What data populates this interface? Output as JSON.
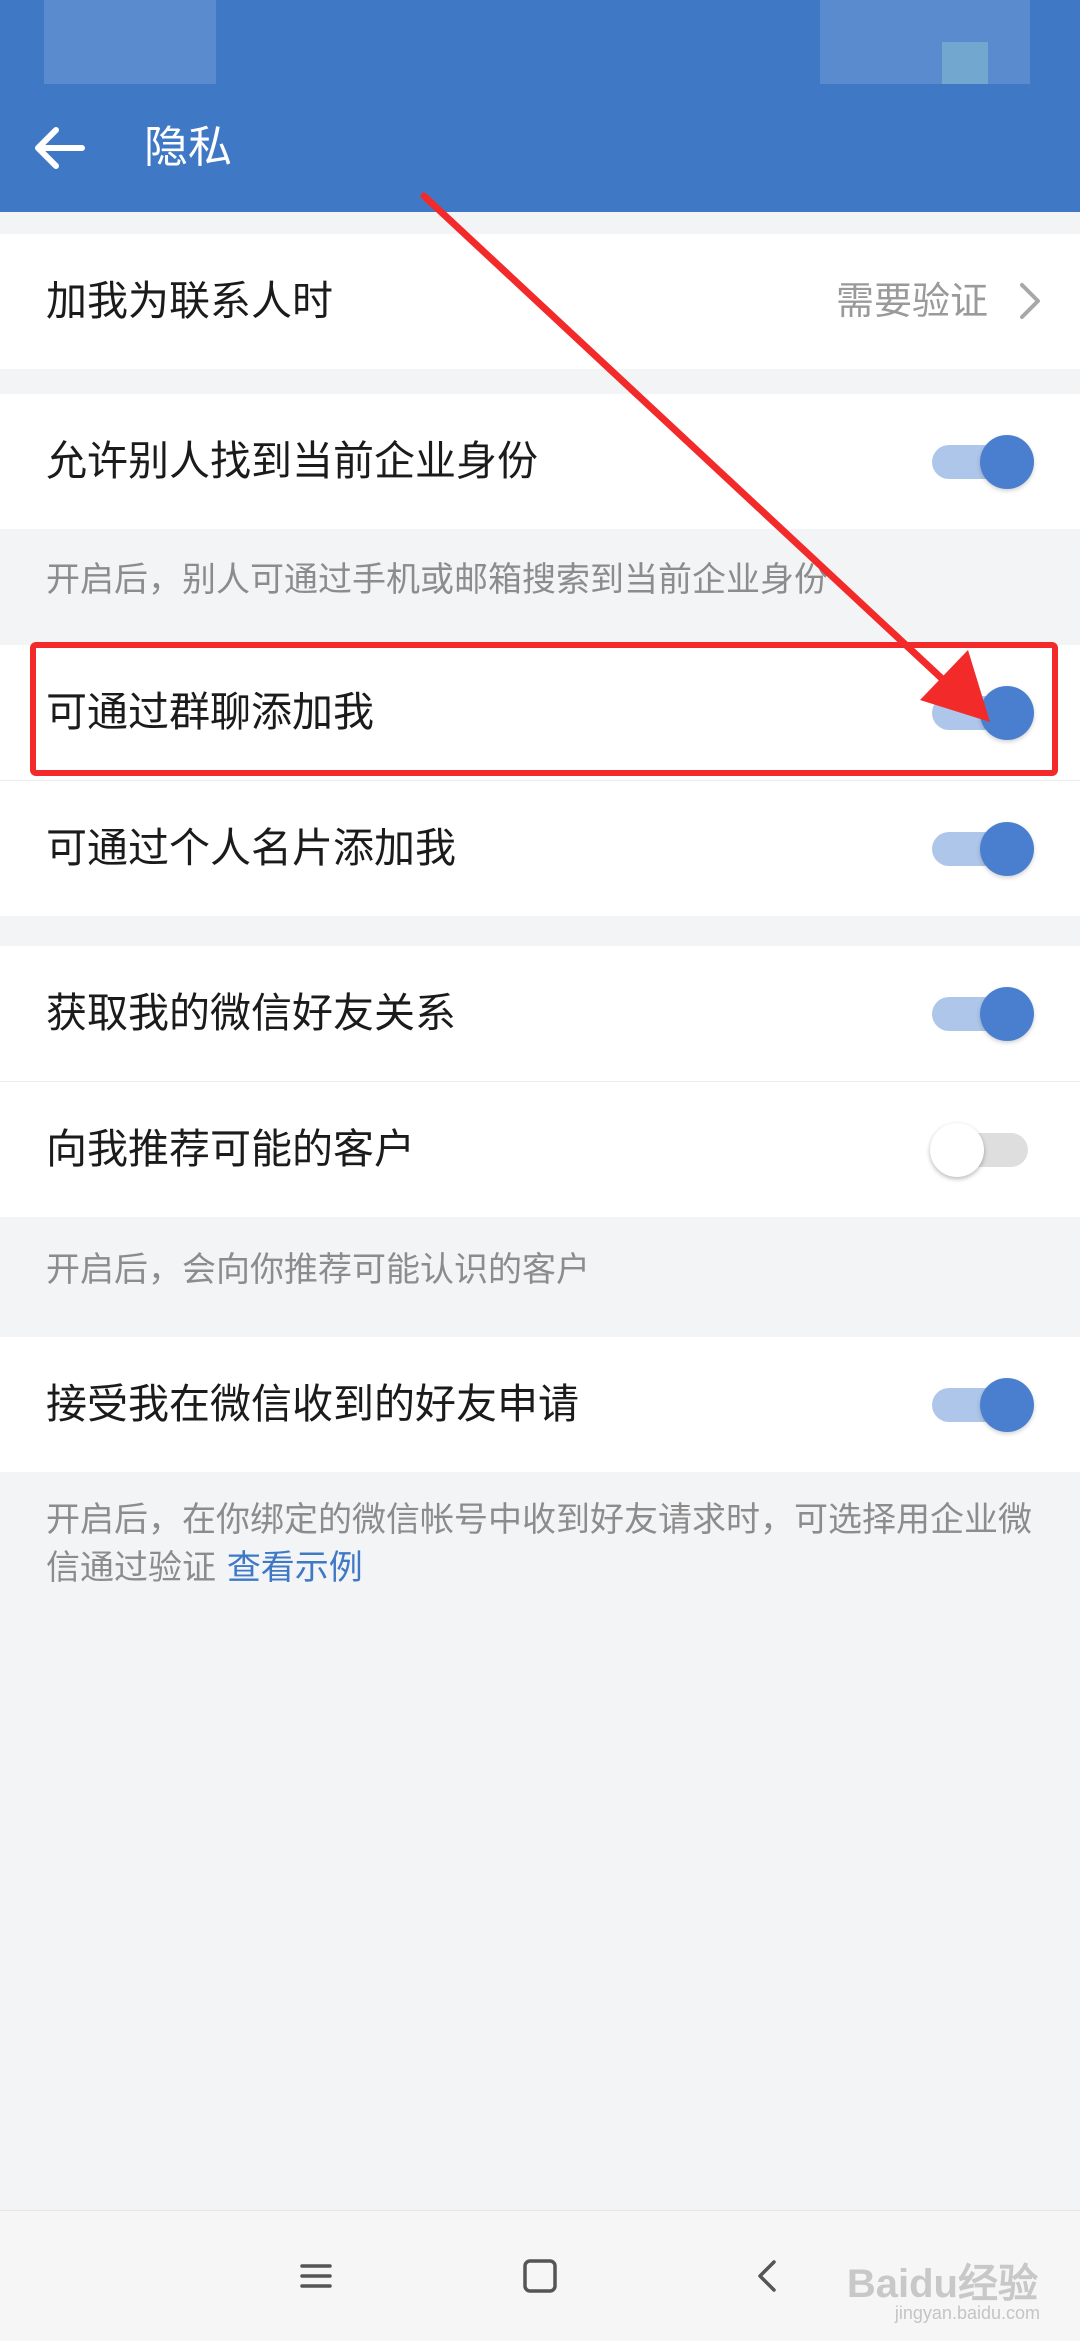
{
  "header": {
    "title": "隐私",
    "back_icon": "arrow-left-icon",
    "background_color": "#3f79c6"
  },
  "sections": {
    "contact": {
      "label": "加我为联系人时",
      "value": "需要验证"
    },
    "identity": {
      "label": "允许别人找到当前企业身份",
      "enabled": true,
      "hint": "开启后，别人可通过手机或邮箱搜索到当前企业身份"
    },
    "group_chat": {
      "label": "可通过群聊添加我",
      "enabled": true
    },
    "business_card": {
      "label": "可通过个人名片添加我",
      "enabled": true
    },
    "wechat_friends": {
      "label": "获取我的微信好友关系",
      "enabled": true
    },
    "recommend": {
      "label": "向我推荐可能的客户",
      "enabled": false,
      "hint": "开启后，会向你推荐可能认识的客户"
    },
    "wechat_requests": {
      "label": "接受我在微信收到的好友申请",
      "enabled": true,
      "hint": "开启后，在你绑定的微信帐号中收到好友请求时，可选择用企业微信通过验证",
      "link": "查看示例"
    }
  },
  "navbar": {
    "icons": [
      "menu-icon",
      "home-icon",
      "back-icon"
    ]
  },
  "watermark": {
    "text": "Baidu经验",
    "sub": "jingyan.baidu.com"
  },
  "colors": {
    "accent": "#4a7fd0",
    "annotation": "#f22a2a"
  }
}
